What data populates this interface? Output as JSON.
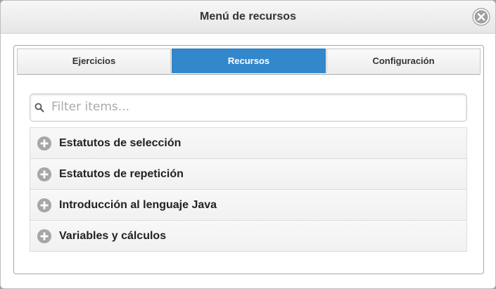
{
  "dialog": {
    "title": "Menú de recursos",
    "close_icon": "close-circle-icon"
  },
  "tabs": [
    {
      "label": "Ejercicios",
      "active": false
    },
    {
      "label": "Recursos",
      "active": true
    },
    {
      "label": "Configuración",
      "active": false
    }
  ],
  "search": {
    "placeholder": "Filter items...",
    "value": "",
    "icon": "search-icon"
  },
  "items": [
    {
      "label": "Estatutos de selección",
      "icon": "plus-circle-icon"
    },
    {
      "label": "Estatutos de repetición",
      "icon": "plus-circle-icon"
    },
    {
      "label": "Introducción al lenguaje Java",
      "icon": "plus-circle-icon"
    },
    {
      "label": "Variables y cálculos",
      "icon": "plus-circle-icon"
    }
  ],
  "colors": {
    "active_tab": "#3388cc",
    "icon_gray": "#a6a6a6"
  }
}
